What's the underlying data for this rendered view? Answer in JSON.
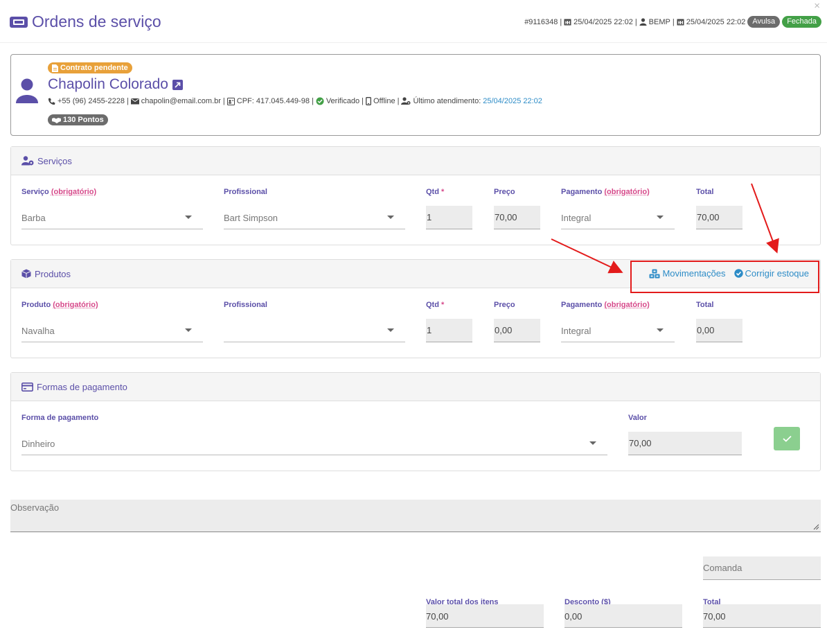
{
  "header": {
    "title": "Ordens de serviço",
    "close": "×",
    "order_id": "#9116348",
    "created_at": "25/04/2025 22:02",
    "user": "BEMP",
    "closed_at": "25/04/2025 22:02",
    "badge_type": "Avulsa",
    "badge_status": "Fechada"
  },
  "client": {
    "contract_badge": "Contrato pendente",
    "name": "Chapolin Colorado",
    "phone": "+55 (96) 2455-2228",
    "email": "chapolin@email.com.br",
    "cpf": "CPF: 417.045.449-98",
    "verified": "Verificado",
    "device": "Offline",
    "last_visit_label": "Último atendimento:",
    "last_visit": "25/04/2025 22:02",
    "points": "130 Pontos"
  },
  "services": {
    "title": "Serviços",
    "labels": {
      "service": "Serviço",
      "required": "(obrigatório)",
      "professional": "Profissional",
      "qty": "Qtd",
      "star": "*",
      "price": "Preço",
      "payment": "Pagamento",
      "total": "Total"
    },
    "row": {
      "service": "Barba",
      "professional": "Bart Simpson",
      "qty": "1",
      "price": "70,00",
      "payment": "Integral",
      "total": "70,00"
    }
  },
  "products": {
    "title": "Produtos",
    "movements": "Movimentações",
    "fix_stock": "Corrigir estoque",
    "labels": {
      "product": "Produto",
      "required": "(obrigatório)",
      "professional": "Profissional",
      "qty": "Qtd",
      "star": "*",
      "price": "Preço",
      "payment": "Pagamento",
      "total": "Total"
    },
    "row": {
      "product": "Navalha",
      "professional": "",
      "qty": "1",
      "price": "0,00",
      "payment": "Integral",
      "total": "0,00"
    }
  },
  "payments": {
    "title": "Formas de pagamento",
    "method_label": "Forma de pagamento",
    "value_label": "Valor",
    "method": "Dinheiro",
    "value": "70,00"
  },
  "observation": {
    "placeholder": "Observação"
  },
  "comanda": {
    "placeholder": "Comanda"
  },
  "totals": {
    "items_label": "Valor total dos itens",
    "items_value": "70,00",
    "discount_label": "Desconto ($)",
    "discount_value": "0,00",
    "total_label": "Total",
    "total_value": "70,00"
  },
  "colors": {
    "brand": "#5b4fa8",
    "link": "#2d8cc7",
    "required": "#d6498a",
    "annotation": "#e31b1b"
  }
}
